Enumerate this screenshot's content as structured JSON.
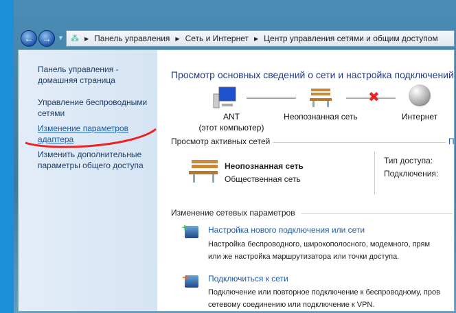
{
  "address": {
    "crumbs": [
      "Панель управления",
      "Сеть и Интернет",
      "Центр управления сетями и общим доступом"
    ]
  },
  "sidebar": {
    "items": [
      {
        "label": "Панель управления - домашняя страница"
      },
      {
        "label": "Управление беспроводными сетями"
      },
      {
        "label": "Изменение параметров адаптера"
      },
      {
        "label": "Изменить дополнительные параметры общего доступа"
      }
    ]
  },
  "main": {
    "title": "Просмотр основных сведений о сети и настройка подключений",
    "map": {
      "computer": "ANT",
      "computer_sub": "(этот компьютер)",
      "network": "Неопознанная сеть",
      "internet": "Интернет"
    },
    "active": {
      "header": "Просмотр активных сетей",
      "header_link": "П",
      "name": "Неопознанная сеть",
      "type": "Общественная сеть",
      "access_label": "Тип доступа:",
      "connections_label": "Подключения:"
    },
    "change": {
      "header": "Изменение сетевых параметров",
      "items": [
        {
          "link": "Настройка нового подключения или сети",
          "desc1": "Настройка беспроводного, широкополосного, модемного, прям",
          "desc2": "или же настройка маршрутизатора или точки доступа."
        },
        {
          "link": "Подключиться к сети",
          "desc1": "Подключение или повторное подключение к беспроводному, пров",
          "desc2": "сетевому соединению или подключение к VPN."
        }
      ]
    }
  }
}
